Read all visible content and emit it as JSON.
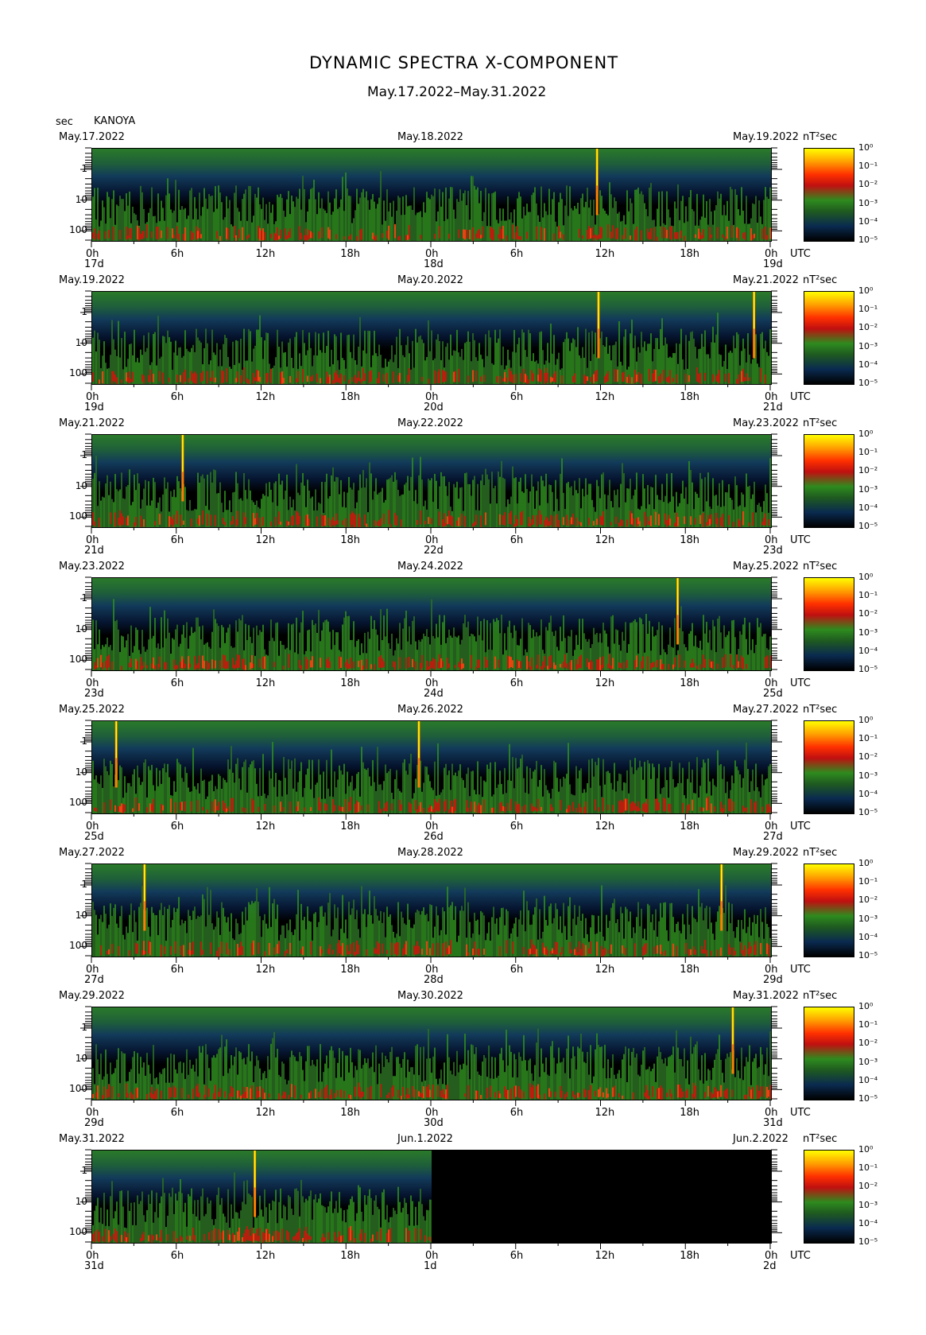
{
  "header": {
    "title": "DYNAMIC SPECTRA X-COMPONENT",
    "subtitle": "May.17.2022–May.31.2022",
    "y_unit": "sec",
    "station": "KANOYA"
  },
  "x_tick_labels": [
    "0h",
    "6h",
    "12h",
    "18h",
    "0h",
    "6h",
    "12h",
    "18h",
    "0h"
  ],
  "x_unit": "UTC",
  "y_tick_labels": [
    "1",
    "10",
    "100"
  ],
  "colorbar": {
    "unit": "nT²sec",
    "labels": [
      "10⁰",
      "10⁻¹",
      "10⁻²",
      "10⁻³",
      "10⁻⁴",
      "10⁻⁵"
    ],
    "colors": [
      "#ffff00",
      "#ff3000",
      "#2e8b1e",
      "#0a2a50",
      "#000000"
    ]
  },
  "chart_data": [
    {
      "type": "heatmap",
      "left_date": "May.17.2022",
      "mid_date": "May.18.2022",
      "right_date": "May.19.2022",
      "day_labels": [
        "17d",
        "18d",
        "19d"
      ],
      "x_range_hours": [
        0,
        48
      ],
      "y_range_sec": [
        0.2,
        200
      ],
      "y_scale": "log",
      "spike_hours": [
        35.7
      ],
      "data_end_hour": 48
    },
    {
      "type": "heatmap",
      "left_date": "May.19.2022",
      "mid_date": "May.20.2022",
      "right_date": "May.21.2022",
      "day_labels": [
        "19d",
        "20d",
        "21d"
      ],
      "x_range_hours": [
        0,
        48
      ],
      "y_range_sec": [
        0.2,
        200
      ],
      "y_scale": "log",
      "spike_hours": [
        35.8,
        46.8
      ],
      "data_end_hour": 48
    },
    {
      "type": "heatmap",
      "left_date": "May.21.2022",
      "mid_date": "May.22.2022",
      "right_date": "May.23.2022",
      "day_labels": [
        "21d",
        "22d",
        "23d"
      ],
      "x_range_hours": [
        0,
        48
      ],
      "y_range_sec": [
        0.2,
        200
      ],
      "y_scale": "log",
      "spike_hours": [
        6.4
      ],
      "data_end_hour": 48
    },
    {
      "type": "heatmap",
      "left_date": "May.23.2022",
      "mid_date": "May.24.2022",
      "right_date": "May.25.2022",
      "day_labels": [
        "23d",
        "24d",
        "25d"
      ],
      "x_range_hours": [
        0,
        48
      ],
      "y_range_sec": [
        0.2,
        200
      ],
      "y_scale": "log",
      "spike_hours": [
        41.4
      ],
      "data_end_hour": 48
    },
    {
      "type": "heatmap",
      "left_date": "May.25.2022",
      "mid_date": "May.26.2022",
      "right_date": "May.27.2022",
      "day_labels": [
        "25d",
        "26d",
        "27d"
      ],
      "x_range_hours": [
        0,
        48
      ],
      "y_range_sec": [
        0.2,
        200
      ],
      "y_scale": "log",
      "spike_hours": [
        1.7,
        23.1
      ],
      "data_end_hour": 48
    },
    {
      "type": "heatmap",
      "left_date": "May.27.2022",
      "mid_date": "May.28.2022",
      "right_date": "May.29.2022",
      "day_labels": [
        "27d",
        "28d",
        "29d"
      ],
      "x_range_hours": [
        0,
        48
      ],
      "y_range_sec": [
        0.2,
        200
      ],
      "y_scale": "log",
      "spike_hours": [
        3.7,
        44.5
      ],
      "data_end_hour": 48
    },
    {
      "type": "heatmap",
      "left_date": "May.29.2022",
      "mid_date": "May.30.2022",
      "right_date": "May.31.2022",
      "day_labels": [
        "29d",
        "30d",
        "31d"
      ],
      "x_range_hours": [
        0,
        48
      ],
      "y_range_sec": [
        0.2,
        200
      ],
      "y_scale": "log",
      "spike_hours": [
        45.3
      ],
      "data_end_hour": 48
    },
    {
      "type": "heatmap",
      "left_date": "May.31.2022",
      "mid_date": "Jun.1.2022",
      "right_date": "Jun.2.2022",
      "day_labels": [
        "31d",
        "1d",
        "2d"
      ],
      "x_range_hours": [
        0,
        48
      ],
      "y_range_sec": [
        0.2,
        200
      ],
      "y_scale": "log",
      "spike_hours": [
        11.5
      ],
      "data_end_hour": 24
    }
  ]
}
